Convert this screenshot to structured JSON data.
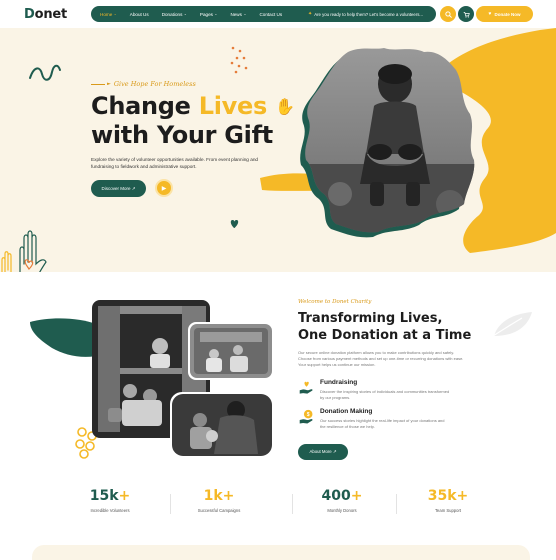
{
  "brand": {
    "logo_letter": "D",
    "logo_rest": "onet"
  },
  "nav": {
    "items": [
      {
        "label": "Home",
        "has_caret": true,
        "active": true
      },
      {
        "label": "About Us",
        "has_caret": false,
        "active": false
      },
      {
        "label": "Donations",
        "has_caret": true,
        "active": false
      },
      {
        "label": "Pages",
        "has_caret": true,
        "active": false
      },
      {
        "label": "News",
        "has_caret": true,
        "active": false
      },
      {
        "label": "Contact Us",
        "has_caret": false,
        "active": false
      }
    ],
    "caret": "⌄",
    "question": "Are you ready to help them? Let's become a volunteers..."
  },
  "header": {
    "donate_label": "Donate Now"
  },
  "hero": {
    "tagline": "Give Hope For Homeless",
    "title_line1_a": "Change ",
    "title_line1_b": "Lives",
    "title_line2": "with Your Gift",
    "description": "Explore the variety of volunteer opportunities available. From event planning and fundraising to fieldwork and administrative support.",
    "button_label": "Discover More ↗"
  },
  "about": {
    "tag": "Welcome to Donet Charity",
    "title_line1": "Transforming Lives,",
    "title_line2": "One Donation at a Time",
    "description": "Our secure online donation platform allows you to make contributions quickly and safely. Choose from various payment methods and set up one-time or recurring donations with ease. Your support helps us continue our mission.",
    "features": [
      {
        "title": "Fundraising",
        "description": "Discover the inspiring stories of individuals and communities transformed by our programs.",
        "icon": "hand-heart-icon"
      },
      {
        "title": "Donation Making",
        "description": "Our success stories highlight the real-life impact of your donations and the resilience of those we help.",
        "icon": "donation-coin-icon"
      }
    ],
    "button_label": "About More ↗"
  },
  "stats": [
    {
      "number": "15k",
      "suffix": "+",
      "label": "Incredible Volunteers",
      "gold": false
    },
    {
      "number": "1k",
      "suffix": "+",
      "label": "Successful Campaigns",
      "gold": true
    },
    {
      "number": "400",
      "suffix": "+",
      "label": "Monthly Donors",
      "gold": false
    },
    {
      "number": "35k",
      "suffix": "+",
      "label": "Team Support",
      "gold": true
    }
  ],
  "colors": {
    "primary": "#1f5c4f",
    "accent": "#f5b927",
    "hero_bg": "#faf4e6"
  }
}
